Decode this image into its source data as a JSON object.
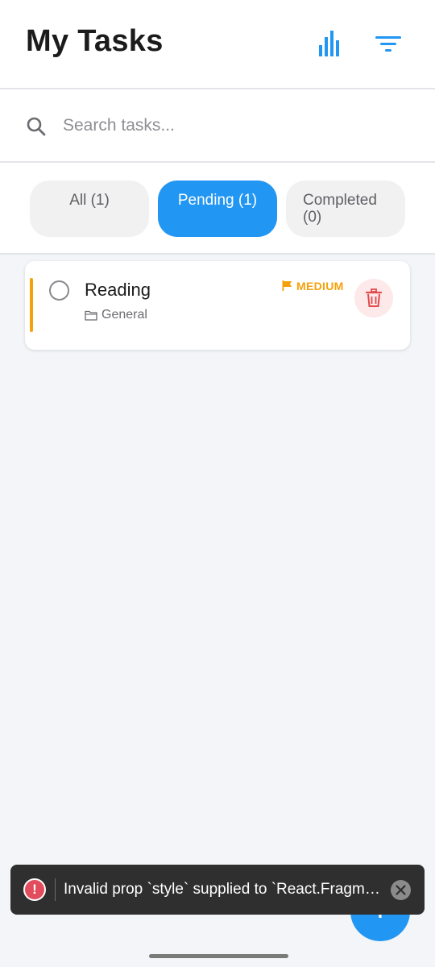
{
  "header": {
    "title": "My Tasks",
    "stats_icon": "bar-chart-icon",
    "filter_icon": "filter-lines-icon"
  },
  "search": {
    "placeholder": "Search tasks...",
    "value": "",
    "icon": "search-icon"
  },
  "tabs": [
    {
      "label": "All (1)",
      "active": false
    },
    {
      "label": "Pending (1)",
      "active": true
    },
    {
      "label": "Completed (0)",
      "active": false
    }
  ],
  "tasks": [
    {
      "title": "Reading",
      "category": "General",
      "category_icon": "folder-icon",
      "priority": "MEDIUM",
      "priority_icon": "flag-icon",
      "completed": false,
      "delete_icon": "trash-icon"
    }
  ],
  "fab": {
    "label": "+"
  },
  "toast": {
    "message": "Invalid prop `style` supplied to `React.Fragment`. React.Fragment can only have `key` and `children` props.",
    "icon": "error-icon",
    "close_icon": "close-icon"
  },
  "colors": {
    "accent": "#2196f3",
    "priority_medium": "#f5a10a",
    "delete": "#e24a4a",
    "background": "#f3f5f9"
  }
}
